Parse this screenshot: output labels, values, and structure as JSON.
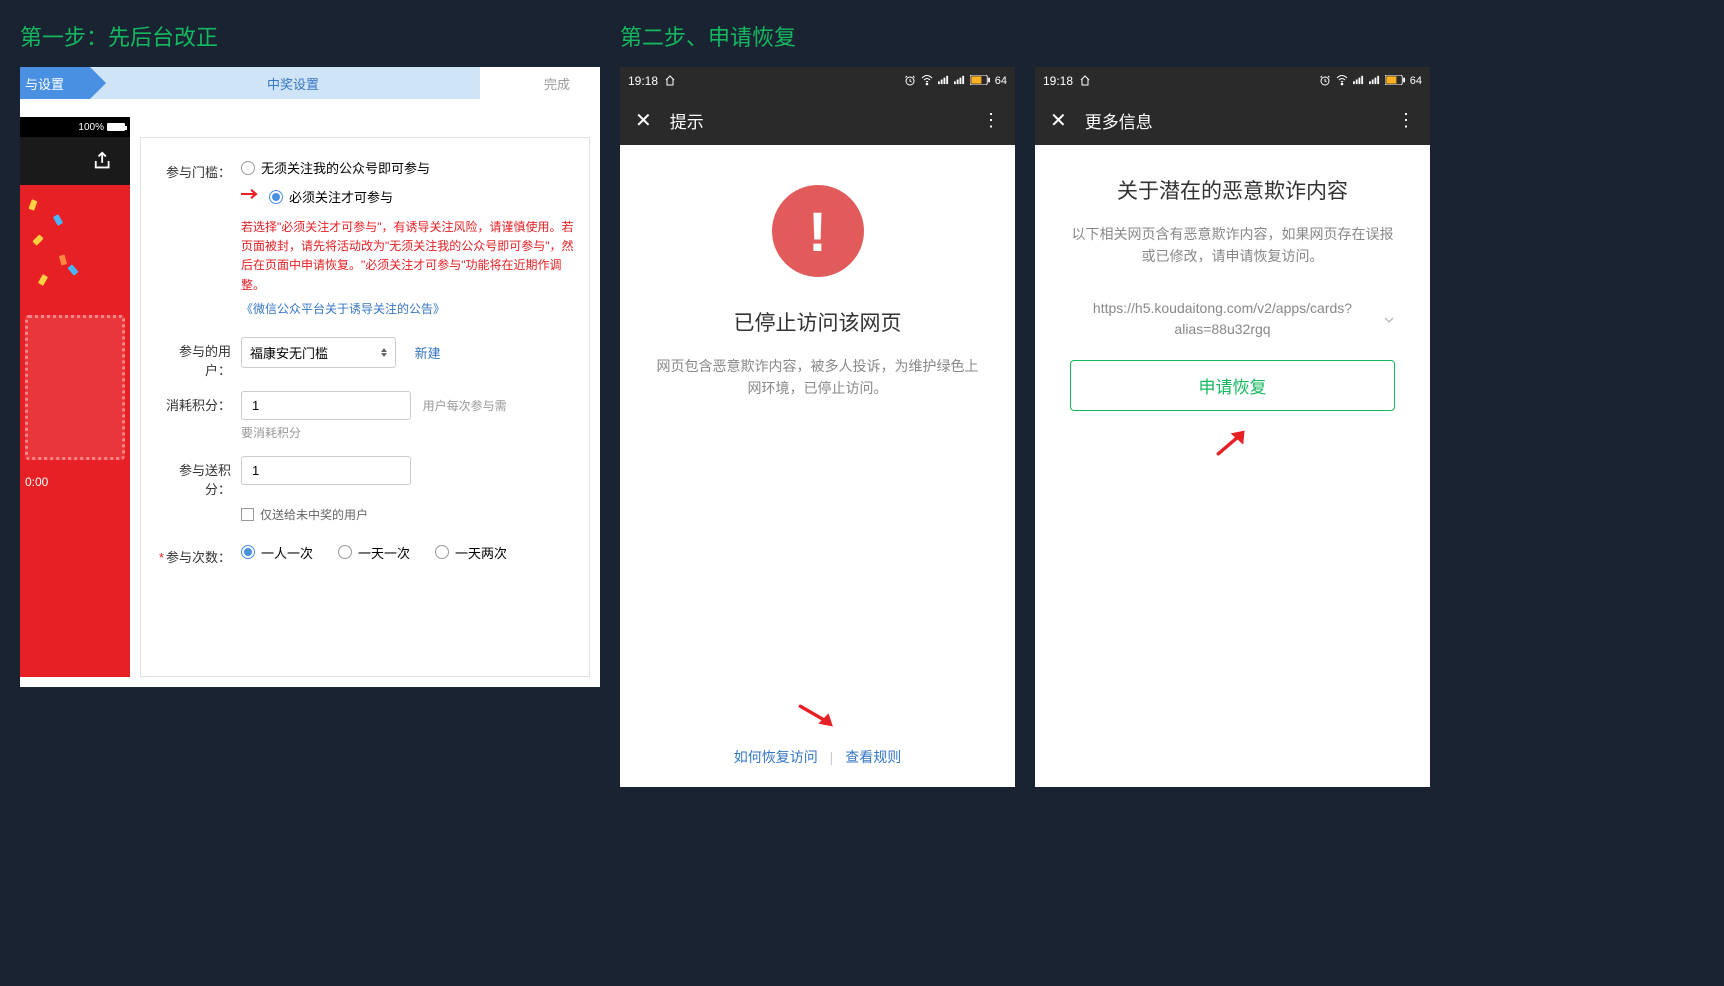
{
  "step1": {
    "title": "第一步：先后台改正",
    "tabs": {
      "active": "与设置",
      "middle": "中奖设置",
      "last": "完成"
    },
    "phonePreview": {
      "battery": "100%",
      "time": "0:00"
    },
    "form": {
      "thresholdLabel": "参与门槛：",
      "thresholdOpt1": "无须关注我的公众号即可参与",
      "thresholdOpt2": "必须关注才可参与",
      "warning": "若选择\"必须关注才可参与\"，有诱导关注风险，请谨慎使用。若页面被封，请先将活动改为\"无须关注我的公众号即可参与\"，然后在页面中申请恢复。\"必须关注才可参与\"功能将在近期作调整。",
      "link": "《微信公众平台关于诱导关注的公告》",
      "userLabel": "参与的用户：",
      "userSelect": "福康安无门槛",
      "newLink": "新建",
      "costLabel": "消耗积分：",
      "costValue": "1",
      "costHint": "用户每次参与需",
      "costHint2": "要消耗积分",
      "bonusLabel": "参与送积分：",
      "bonusValue": "1",
      "bonusCheckbox": "仅送给未中奖的用户",
      "countLabel": "参与次数：",
      "countOpt1": "一人一次",
      "countOpt2": "一天一次",
      "countOpt3": "一天两次"
    }
  },
  "step2": {
    "title": "第二步、申请恢复",
    "statusBar": {
      "time": "19:18",
      "battery": "64"
    },
    "phone1": {
      "header": "提示",
      "heading": "已停止访问该网页",
      "desc": "网页包含恶意欺诈内容，被多人投诉，为维护绿色上网环境，已停止访问。",
      "footerLink1": "如何恢复访问",
      "footerLink2": "查看规则"
    },
    "phone2": {
      "header": "更多信息",
      "heading": "关于潜在的恶意欺诈内容",
      "desc": "以下相关网页含有恶意欺诈内容，如果网页存在误报或已修改，请申请恢复访问。",
      "url": "https://h5.koudaitong.com/v2/apps/cards?alias=88u32rgq",
      "button": "申请恢复"
    }
  }
}
